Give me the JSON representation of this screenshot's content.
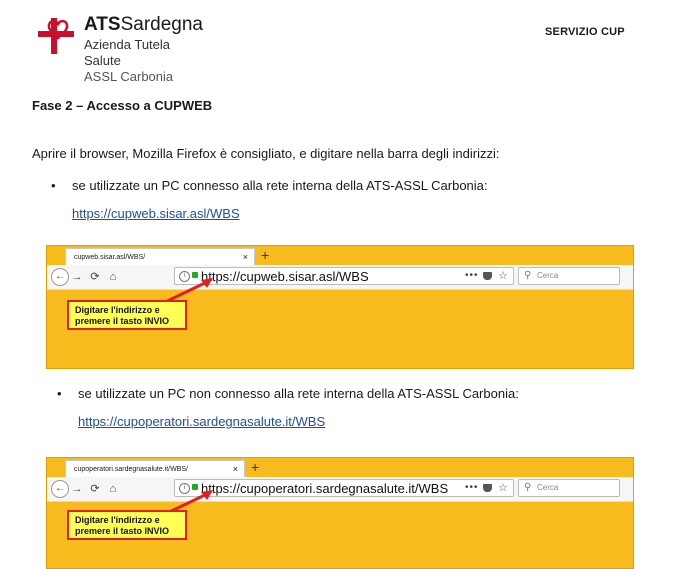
{
  "header": {
    "brand_bold": "ATS",
    "brand_rest": "Sardegna",
    "subtitle1": "Azienda Tutela Salute",
    "subtitle2": "ASSL Carbonia",
    "service": "SERVIZIO CUP"
  },
  "section_title": "Fase 2 – Accesso a CUPWEB",
  "intro": "Aprire il browser, Mozilla Firefox è consigliato, e digitare nella barra degli indirizzi:",
  "bullets": [
    {
      "text": "se utilizzate un PC connesso alla rete interna della ATS-ASSL Carbonia:",
      "link": "https://cupweb.sisar.asl/WBS",
      "browser": {
        "tab_title": "cupweb.sisar.asl/WBS/",
        "url": "https://cupweb.sisar.asl/WBS",
        "search_placeholder": "Cerca",
        "callout_line1": "Digitare l'indirizzo e",
        "callout_line2": "premere il tasto INVIO"
      }
    },
    {
      "text": "se utilizzate un PC non connesso alla rete interna della ATS-ASSL Carbonia:",
      "link": "https://cupoperatori.sardegnasalute.it/WBS",
      "browser": {
        "tab_title": "cupoperatori.sardegnasalute.it/WBS/",
        "url": "https://cupoperatori.sardegnasalute.it/WBS",
        "search_placeholder": "Cerca",
        "callout_line1": "Digitare l'indirizzo e",
        "callout_line2": "premere il tasto INVIO"
      }
    }
  ],
  "glyphs": {
    "bullet": "•",
    "close": "×",
    "plus": "+",
    "back": "←",
    "forward": "→",
    "reload": "⟳",
    "home": "⌂",
    "info": "i",
    "dots": "•••",
    "star": "☆",
    "search": "⚲"
  },
  "colors": {
    "accent_yellow": "#f7bb1e",
    "callout_fill": "#ffff55",
    "callout_border": "#e02020",
    "link": "#1f4fa3",
    "logo_red": "#c8102e"
  },
  "icons": [
    "logo-cross-heart",
    "back-icon",
    "forward-icon",
    "reload-icon",
    "home-icon",
    "info-icon",
    "lock-icon",
    "more-icon",
    "pocket-icon",
    "star-icon",
    "search-icon",
    "close-icon",
    "new-tab-icon"
  ]
}
